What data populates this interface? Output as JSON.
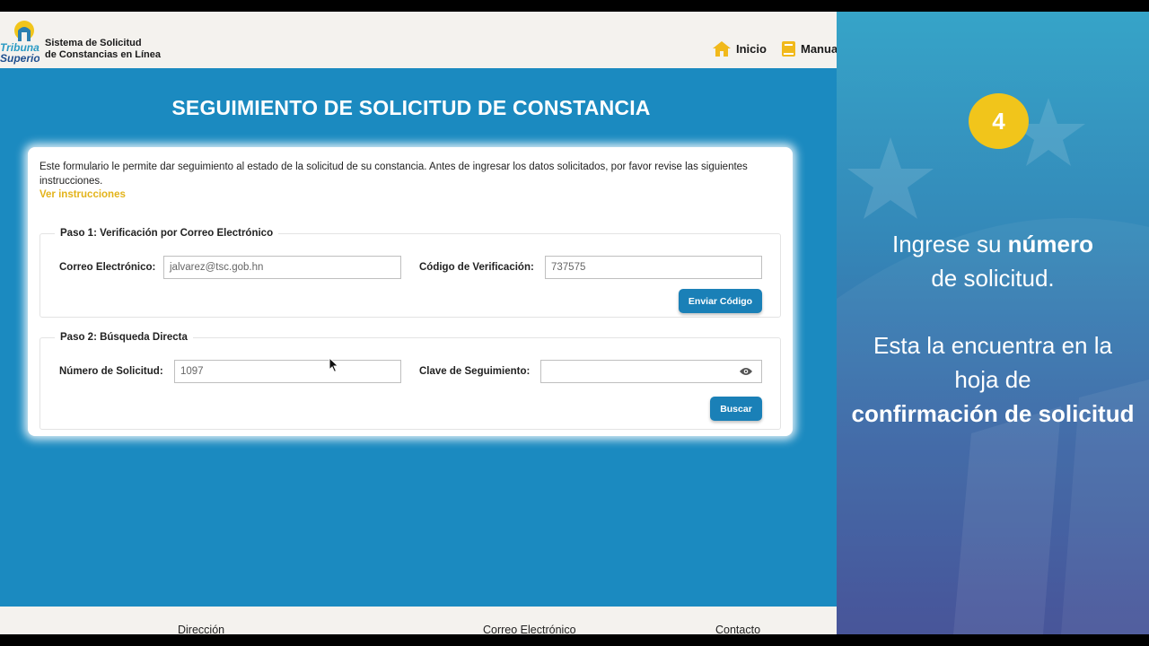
{
  "header": {
    "logo_text_line1": "Tribunal",
    "logo_text_line2": "Superior",
    "app_name_line1": "Sistema de Solicitud",
    "app_name_line2": "de Constancias en Línea",
    "nav": {
      "home": "Inicio",
      "manual": "Manual"
    }
  },
  "page": {
    "title": "SEGUIMIENTO DE SOLICITUD DE CONSTANCIA",
    "intro": "Este formulario le permite dar seguimiento al estado de la solicitud de su constancia. Antes de ingresar los datos solicitados, por favor revise las siguientes instrucciones.",
    "instructions_link": "Ver instrucciones"
  },
  "step1": {
    "legend": "Paso 1: Verificación por Correo Electrónico",
    "email_label": "Correo Electrónico:",
    "email_value": "jalvarez@tsc.gob.hn",
    "code_label": "Código de Verificación:",
    "code_value": "737575",
    "send_button": "Enviar Código"
  },
  "step2": {
    "legend": "Paso 2: Búsqueda Directa",
    "number_label": "Número de Solicitud:",
    "number_value": "1097",
    "key_label": "Clave de Seguimiento:",
    "key_value": "",
    "search_button": "Buscar"
  },
  "footer": {
    "address": "Dirección",
    "email": "Correo Electrónico",
    "contact": "Contacto"
  },
  "panel": {
    "step_number": "4",
    "line1_pre": "Ingrese su ",
    "line1_bold": "número",
    "line1_post": "de solicitud.",
    "line2_pre": "Esta la encuentra en la hoja de ",
    "line2_bold": "confirmación de solicitud"
  },
  "colors": {
    "page_bg": "#1b8ac0",
    "button": "#1a80b7",
    "link": "#e3b31a",
    "badge": "#f1c51b"
  }
}
